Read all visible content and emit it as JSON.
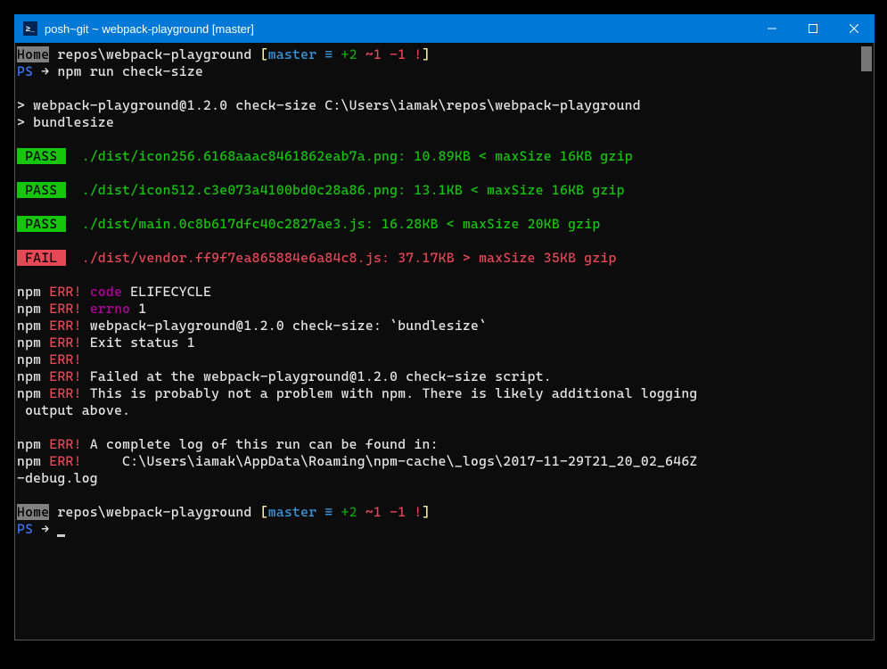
{
  "titlebar": {
    "icon_text": "≥_",
    "title": "posh~git ~ webpack-playground [master]"
  },
  "prompt1": {
    "home": "Home",
    "path": " repos\\webpack-playground ",
    "bracket_open": "[",
    "branch": "master",
    "equiv": " ≡ ",
    "ahead": "+2",
    "mod": " ~1 ",
    "del": "-1",
    "excl": " !",
    "bracket_close": "]"
  },
  "ps_line": {
    "ps": "PS",
    "arrow": " → ",
    "cmd": "npm run check-size"
  },
  "npm_header": {
    "line1": "> webpack-playground@1.2.0 check-size C:\\Users\\iamak\\repos\\webpack-playground",
    "line2": "> bundlesize"
  },
  "results": [
    {
      "status": "PASS",
      "text": "./dist/icon256.6168aaac8461862eab7a.png: 10.89KB < maxSize 16KB gzip",
      "pass": true
    },
    {
      "status": "PASS",
      "text": "./dist/icon512.c3e073a4100bd0c28a86.png: 13.1KB < maxSize 16KB gzip",
      "pass": true
    },
    {
      "status": "PASS",
      "text": "./dist/main.0c8b617dfc40c2827ae3.js: 16.28KB < maxSize 20KB gzip",
      "pass": true
    },
    {
      "status": "FAIL",
      "text": "./dist/vendor.ff9f7ea865884e6a84c8.js: 37.17KB > maxSize 35KB gzip",
      "pass": false
    }
  ],
  "err": {
    "npm": "npm",
    "err": " ERR!",
    "code_label": " code",
    "code_val": " ELIFECYCLE",
    "errno_label": " errno",
    "errno_val": " 1",
    "l3": " webpack-playground@1.2.0 check-size: `bundlesize`",
    "l4": " Exit status 1",
    "l6": " Failed at the webpack-playground@1.2.0 check-size script.",
    "l7": " This is probably not a problem with npm. There is likely additional logging",
    "l7b": " output above.",
    "l9": " A complete log of this run can be found in:",
    "l10": "     C:\\Users\\iamak\\AppData\\Roaming\\npm-cache\\_logs\\2017-11-29T21_20_02_646Z",
    "l10b": "-debug.log"
  },
  "prompt2": {
    "ps": "PS",
    "arrow": " → "
  }
}
